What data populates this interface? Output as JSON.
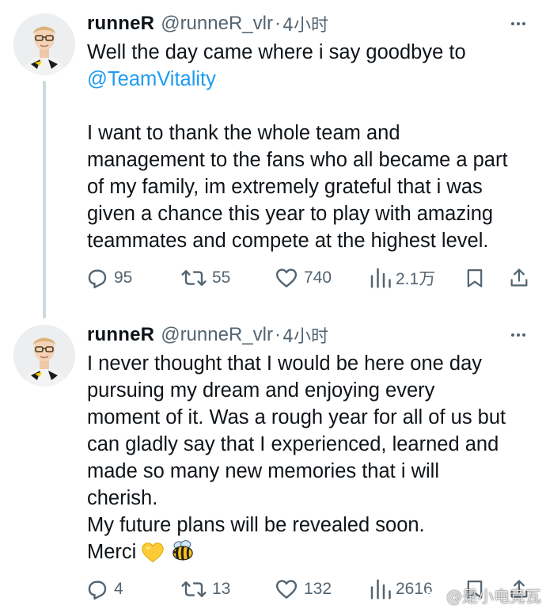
{
  "tweets": [
    {
      "name": "runneR",
      "handle": "@runneR_vlr",
      "separator": "·",
      "time": "4小时",
      "lines": [
        {
          "text": "Well the day came where i say goodbye to"
        },
        {
          "mention": "@TeamVitality"
        },
        {
          "gap": true
        },
        {
          "text": "I want to thank the whole team and"
        },
        {
          "text": "management to the fans who all became a part"
        },
        {
          "text": "of my family, im extremely grateful that i was"
        },
        {
          "text": "given a chance this year to play with amazing"
        },
        {
          "text": "teammates and compete at the highest level."
        }
      ],
      "actions": {
        "replies": "95",
        "reposts": "55",
        "likes": "740",
        "views": "2.1万"
      }
    },
    {
      "name": "runneR",
      "handle": "@runneR_vlr",
      "separator": "·",
      "time": "4小时",
      "lines": [
        "I never thought that I would be here one day",
        "pursuing my dream and enjoying every",
        "moment of it. Was a rough year for all of us but",
        "can gladly say that I experienced, learned and",
        "made so many new memories that i will",
        "cherish.",
        "My future plans will be revealed soon.",
        "Merci"
      ],
      "emojis": [
        "yellow-heart-emoji",
        "bee-emoji"
      ],
      "actions": {
        "replies": "4",
        "reposts": "13",
        "likes": "132",
        "views": "2616"
      }
    }
  ],
  "icons": {
    "reply": "reply-icon",
    "repost": "repost-icon",
    "like": "heart-icon",
    "views": "views-icon",
    "bookmark": "bookmark-icon",
    "share": "share-icon",
    "more": "more-icon"
  },
  "watermark": "@是小电竞瓦",
  "colors": {
    "text": "#0f1419",
    "secondary": "#536471",
    "link": "#1d9bf0",
    "thread_line": "#cfd9de"
  }
}
